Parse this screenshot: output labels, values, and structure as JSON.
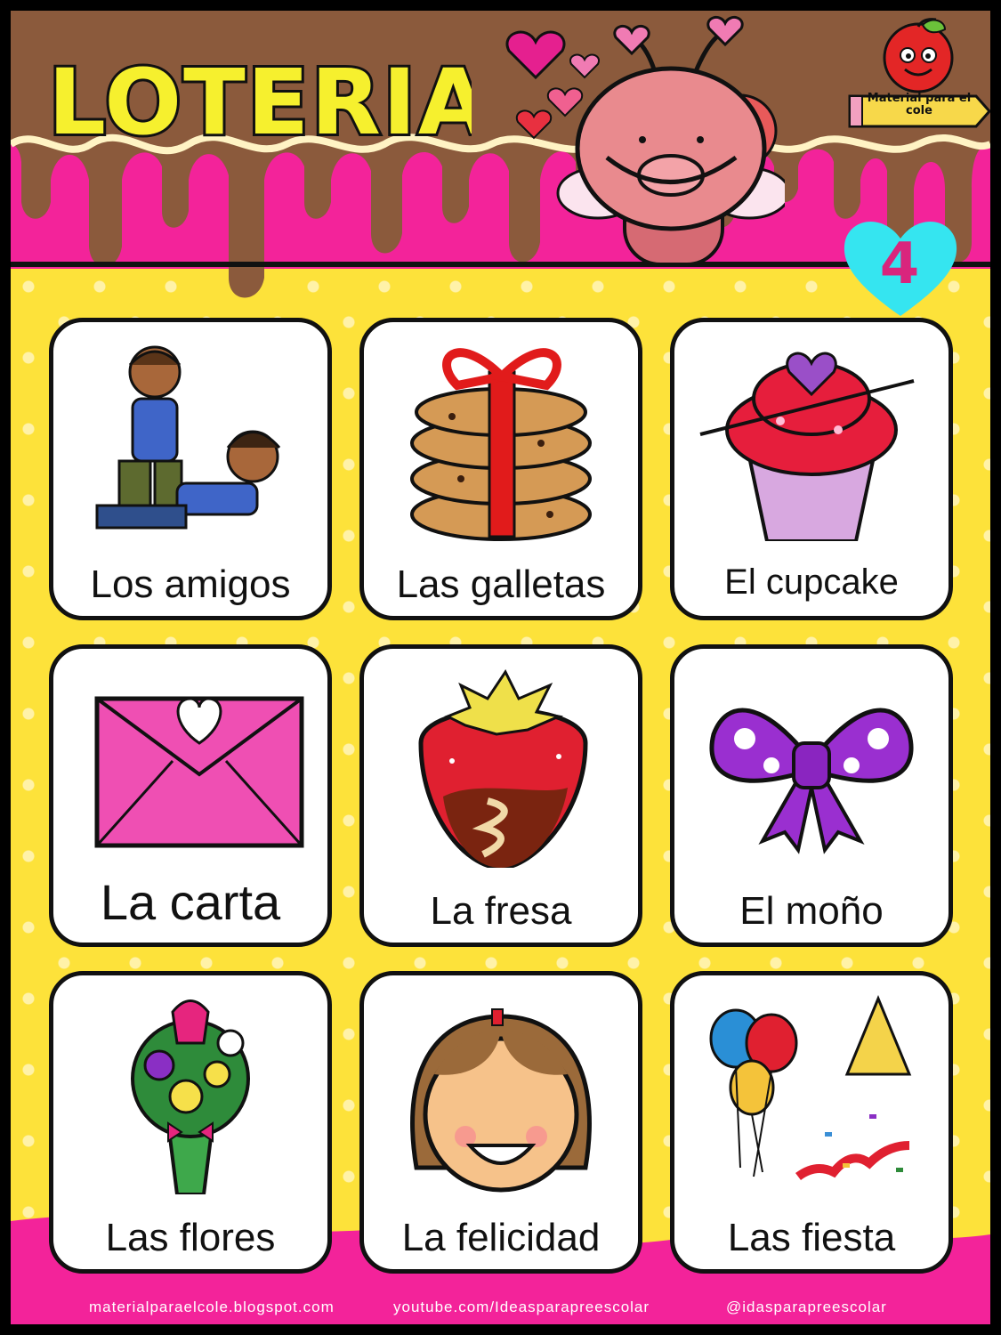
{
  "header": {
    "title": "LOTERIA",
    "card_number": "4",
    "logo_text": "Material para el cole",
    "colors": {
      "pink": "#f3239a",
      "chocolate": "#8b5a3c",
      "yellow": "#fde23a",
      "cyan": "#35e5f0"
    }
  },
  "cards": [
    {
      "label": "Los amigos",
      "icon": "friends-icon"
    },
    {
      "label": "Las galletas",
      "icon": "cookies-icon"
    },
    {
      "label": "El cupcake",
      "icon": "cupcake-icon"
    },
    {
      "label": "La carta",
      "icon": "envelope-icon"
    },
    {
      "label": "La fresa",
      "icon": "strawberry-icon"
    },
    {
      "label": "El moño",
      "icon": "bow-icon"
    },
    {
      "label": "Las flores",
      "icon": "bouquet-icon"
    },
    {
      "label": "La felicidad",
      "icon": "happy-face-icon"
    },
    {
      "label": "Las fiesta",
      "icon": "party-icon"
    }
  ],
  "footer": {
    "blog": "materialparaelcole.blogspot.com",
    "youtube": "youtube.com/Ideasparapreescolar",
    "instagram": "@idasparapreescolar"
  }
}
